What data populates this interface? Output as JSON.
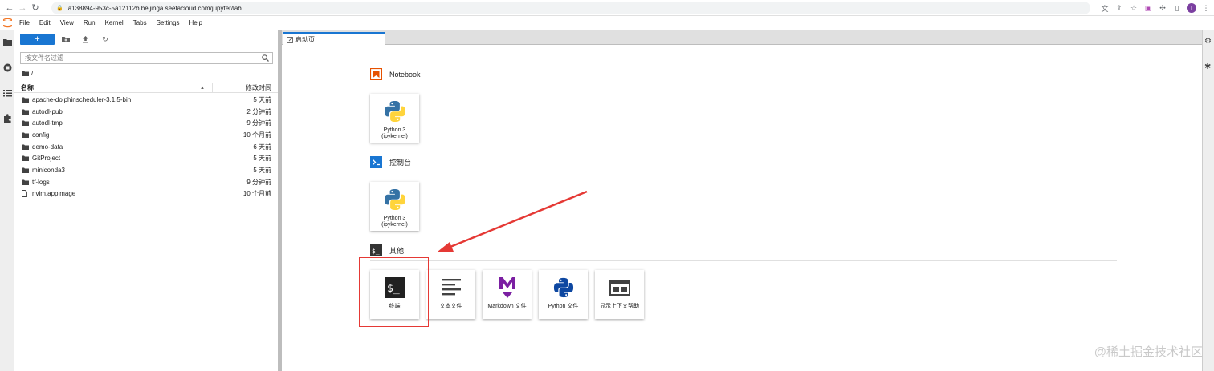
{
  "browser": {
    "url": "a138894-953c-5a12112b.beijinga.seetacloud.com/jupyter/lab",
    "profile_initial": "I"
  },
  "menubar": {
    "items": [
      "File",
      "Edit",
      "View",
      "Run",
      "Kernel",
      "Tabs",
      "Settings",
      "Help"
    ]
  },
  "filebrowser": {
    "new_label": "+",
    "filter_placeholder": "按文件名过滤",
    "breadcrumb": "/",
    "col_name": "名称",
    "col_modified": "修改时间",
    "files": [
      {
        "name": "apache-dolphinscheduler-3.1.5-bin",
        "modified": "5 天前",
        "type": "folder"
      },
      {
        "name": "autodl-pub",
        "modified": "2 分钟前",
        "type": "folder"
      },
      {
        "name": "autodl-tmp",
        "modified": "9 分钟前",
        "type": "folder"
      },
      {
        "name": "config",
        "modified": "10 个月前",
        "type": "folder"
      },
      {
        "name": "demo-data",
        "modified": "6 天前",
        "type": "folder"
      },
      {
        "name": "GitProject",
        "modified": "5 天前",
        "type": "folder"
      },
      {
        "name": "miniconda3",
        "modified": "5 天前",
        "type": "folder"
      },
      {
        "name": "tf-logs",
        "modified": "9 分钟前",
        "type": "folder"
      },
      {
        "name": "nvim.appimage",
        "modified": "10 个月前",
        "type": "file"
      }
    ]
  },
  "tab": {
    "label": "启动页"
  },
  "launcher": {
    "notebook": {
      "title": "Notebook",
      "cards": [
        {
          "label1": "Python 3",
          "label2": "(ipykernel)"
        }
      ]
    },
    "console": {
      "title": "控制台",
      "cards": [
        {
          "label1": "Python 3",
          "label2": "(ipykernel)"
        }
      ]
    },
    "other": {
      "title": "其他",
      "cards": [
        {
          "label": "终端"
        },
        {
          "label": "文本文件"
        },
        {
          "label": "Markdown 文件"
        },
        {
          "label": "Python 文件"
        },
        {
          "label": "显示上下文帮助"
        }
      ]
    }
  },
  "watermark": "@稀土掘金技术社区",
  "colors": {
    "accent": "#1976d2",
    "notebook_icon": "#e65100",
    "markdown_icon": "#7b1fa2",
    "annotation_red": "#e53935"
  }
}
